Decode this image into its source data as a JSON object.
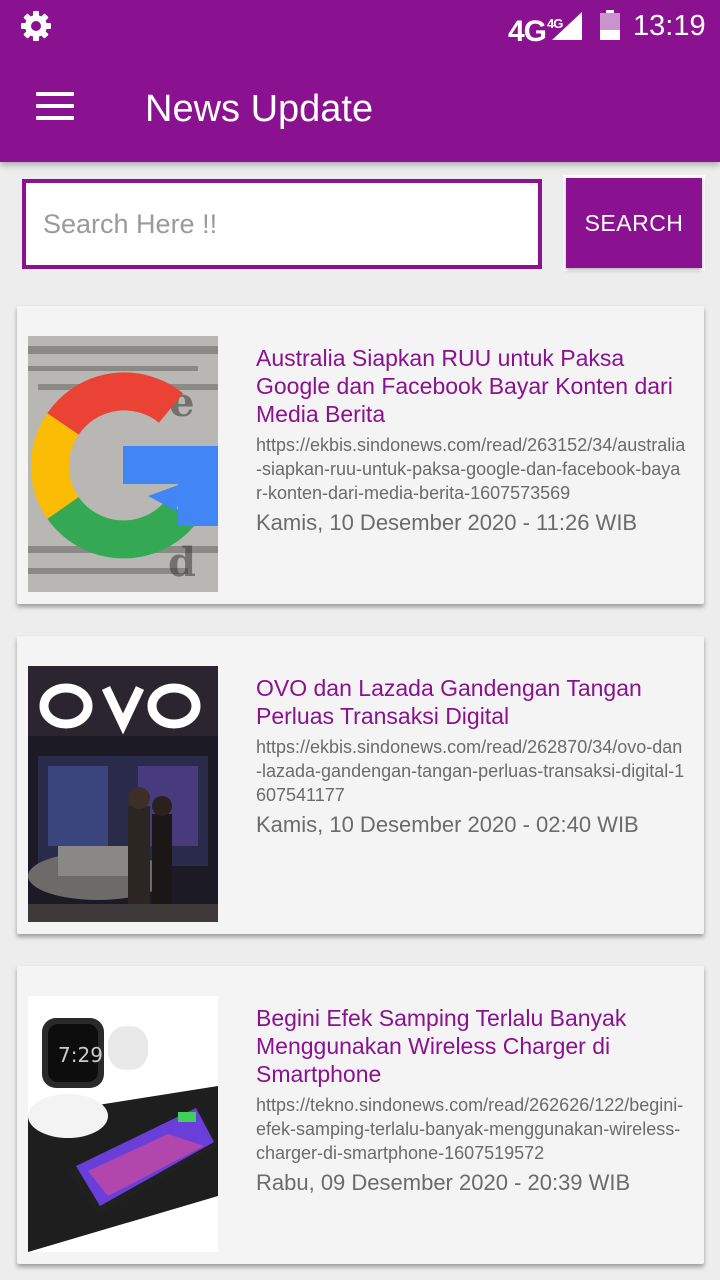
{
  "status_bar": {
    "network": "4G",
    "network_sup": "4G",
    "time": "13:19",
    "icons": [
      "gear-icon",
      "signal-icon",
      "battery-icon"
    ]
  },
  "app_bar": {
    "title": "News Update",
    "menu_icon": "hamburger-menu-icon"
  },
  "search": {
    "placeholder": "Search Here !!",
    "value": "",
    "button_label": "SEARCH"
  },
  "colors": {
    "primary": "#8a118f",
    "background": "#ededed",
    "card": "#f4f4f4",
    "meta_text": "#6b6b6b"
  },
  "articles": [
    {
      "title": "Australia Siapkan RUU untuk Paksa Google dan Facebook Bayar Konten dari Media Berita",
      "url": "https://ekbis.sindonews.com/read/263152/34/australia-siapkan-ruu-untuk-paksa-google-dan-facebook-bayar-konten-dari-media-berita-1607573569",
      "date": "Kamis, 10 Desember 2020 - 11:26 WIB",
      "thumbnail": "google-logo-newspaper-image"
    },
    {
      "title": "OVO dan Lazada Gandengan Tangan Perluas Transaksi Digital",
      "url": "https://ekbis.sindonews.com/read/262870/34/ovo-dan-lazada-gandengan-tangan-perluas-transaksi-digital-1607541177",
      "date": "Kamis, 10 Desember 2020 - 02:40 WIB",
      "thumbnail": "ovo-booth-image"
    },
    {
      "title": "Begini Efek Samping Terlalu Banyak Menggunakan Wireless Charger di Smartphone",
      "url": "https://tekno.sindonews.com/read/262626/122/begini-efek-samping-terlalu-banyak-menggunakan-wireless-charger-di-smartphone-1607519572",
      "date": "Rabu, 09 Desember 2020 - 20:39 WIB",
      "thumbnail": "wireless-charger-image"
    }
  ]
}
